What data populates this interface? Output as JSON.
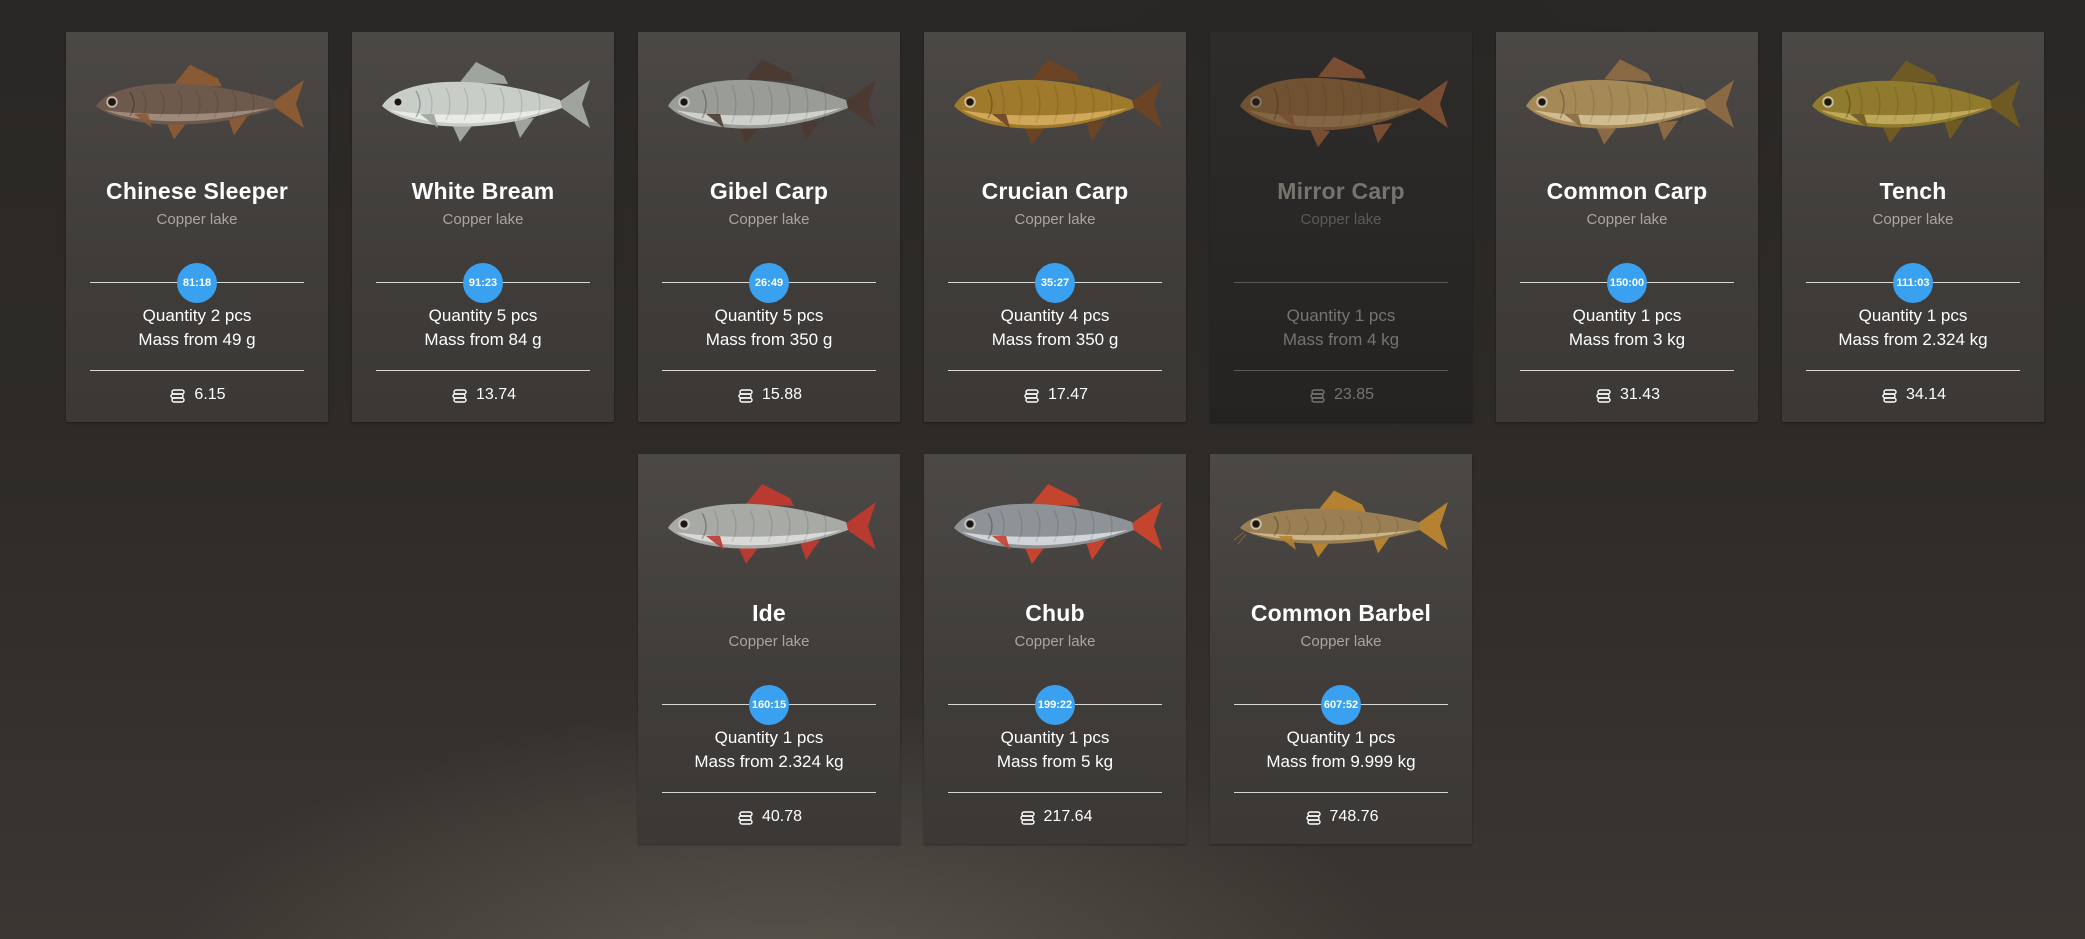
{
  "fish": [
    {
      "name": "Chinese Sleeper",
      "location": "Copper lake",
      "timer": "81:18",
      "quantity": "Quantity 2 pcs",
      "mass": "Mass from 49 g",
      "price": "6.15",
      "locked": false,
      "icon": "chinese-sleeper-fish-icon"
    },
    {
      "name": "White Bream",
      "location": "Copper lake",
      "timer": "91:23",
      "quantity": "Quantity 5 pcs",
      "mass": "Mass from 84 g",
      "price": "13.74",
      "locked": false,
      "icon": "white-bream-fish-icon"
    },
    {
      "name": "Gibel Carp",
      "location": "Copper lake",
      "timer": "26:49",
      "quantity": "Quantity 5 pcs",
      "mass": "Mass from 350 g",
      "price": "15.88",
      "locked": false,
      "icon": "gibel-carp-fish-icon"
    },
    {
      "name": "Crucian Carp",
      "location": "Copper lake",
      "timer": "35:27",
      "quantity": "Quantity 4 pcs",
      "mass": "Mass from 350 g",
      "price": "17.47",
      "locked": false,
      "icon": "crucian-carp-fish-icon"
    },
    {
      "name": "Mirror Carp",
      "location": "Copper lake",
      "timer": null,
      "quantity": "Quantity 1 pcs",
      "mass": "Mass from 4 kg",
      "price": "23.85",
      "locked": true,
      "icon": "mirror-carp-fish-icon"
    },
    {
      "name": "Common Carp",
      "location": "Copper lake",
      "timer": "150:00",
      "quantity": "Quantity 1 pcs",
      "mass": "Mass from 3 kg",
      "price": "31.43",
      "locked": false,
      "icon": "common-carp-fish-icon"
    },
    {
      "name": "Tench",
      "location": "Copper lake",
      "timer": "111:03",
      "quantity": "Quantity 1 pcs",
      "mass": "Mass from 2.324 kg",
      "price": "34.14",
      "locked": false,
      "icon": "tench-fish-icon"
    },
    {
      "name": "Ide",
      "location": "Copper lake",
      "timer": "160:15",
      "quantity": "Quantity 1 pcs",
      "mass": "Mass from 2.324 kg",
      "price": "40.78",
      "locked": false,
      "icon": "ide-fish-icon"
    },
    {
      "name": "Chub",
      "location": "Copper lake",
      "timer": "199:22",
      "quantity": "Quantity 1 pcs",
      "mass": "Mass from 5 kg",
      "price": "217.64",
      "locked": false,
      "icon": "chub-fish-icon"
    },
    {
      "name": "Common Barbel",
      "location": "Copper lake",
      "timer": "607:52",
      "quantity": "Quantity 1 pcs",
      "mass": "Mass from 9.999 kg",
      "price": "748.76",
      "locked": false,
      "icon": "common-barbel-fish-icon"
    }
  ],
  "colors": {
    "timer_badge": "#3aa0f0",
    "card_bg": "#45423f",
    "locked_card_bg": "#2a2826",
    "location_text": "#a9a6a1"
  },
  "price_icon": "coin-stack-icon"
}
